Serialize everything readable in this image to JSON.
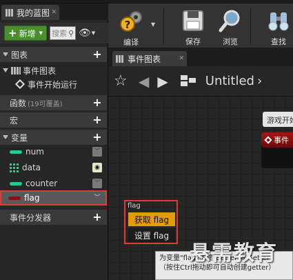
{
  "left_panel": {
    "tab_label": "我的蓝图",
    "add_button": "新增",
    "search_placeholder": "搜索",
    "sections": {
      "graphs": "图表",
      "event_graph": "事件图表",
      "event_begin_play": "事件开始运行",
      "functions": "函数",
      "functions_hint": "(19可覆盖)",
      "macros": "宏",
      "variables": "变量",
      "event_dispatchers": "事件分发器"
    },
    "variables": [
      {
        "name": "num",
        "color": "#2ec38f",
        "visible": false
      },
      {
        "name": "data",
        "color": "#3ac48b",
        "visible": true
      },
      {
        "name": "counter",
        "color": "#2ec38f",
        "visible": false
      },
      {
        "name": "flag",
        "color": "#8a0f0f",
        "visible": false
      }
    ]
  },
  "toolbar": {
    "compile": "编译",
    "save": "保存",
    "browse": "浏览",
    "find": "查找"
  },
  "graph_tab": {
    "label": "事件图表"
  },
  "breadcrumb": {
    "title": "Untitled"
  },
  "graph": {
    "node_tooltip": "游戏开始",
    "event_node_title": "事件"
  },
  "context_menu": {
    "title": "flag",
    "get_label": "获取 flag",
    "set_label": "设置 flag"
  },
  "tooltip": {
    "line1": "为变量\"flag\"创建 Getter 或 Setter",
    "line2": "（按住Ctrl拖动即可自动创建getter）"
  },
  "watermark": "悬需教育",
  "colors": {
    "accent_green": "#4a8f2e",
    "highlight_red": "#e23a3a",
    "menu_highlight": "#e39b00"
  }
}
